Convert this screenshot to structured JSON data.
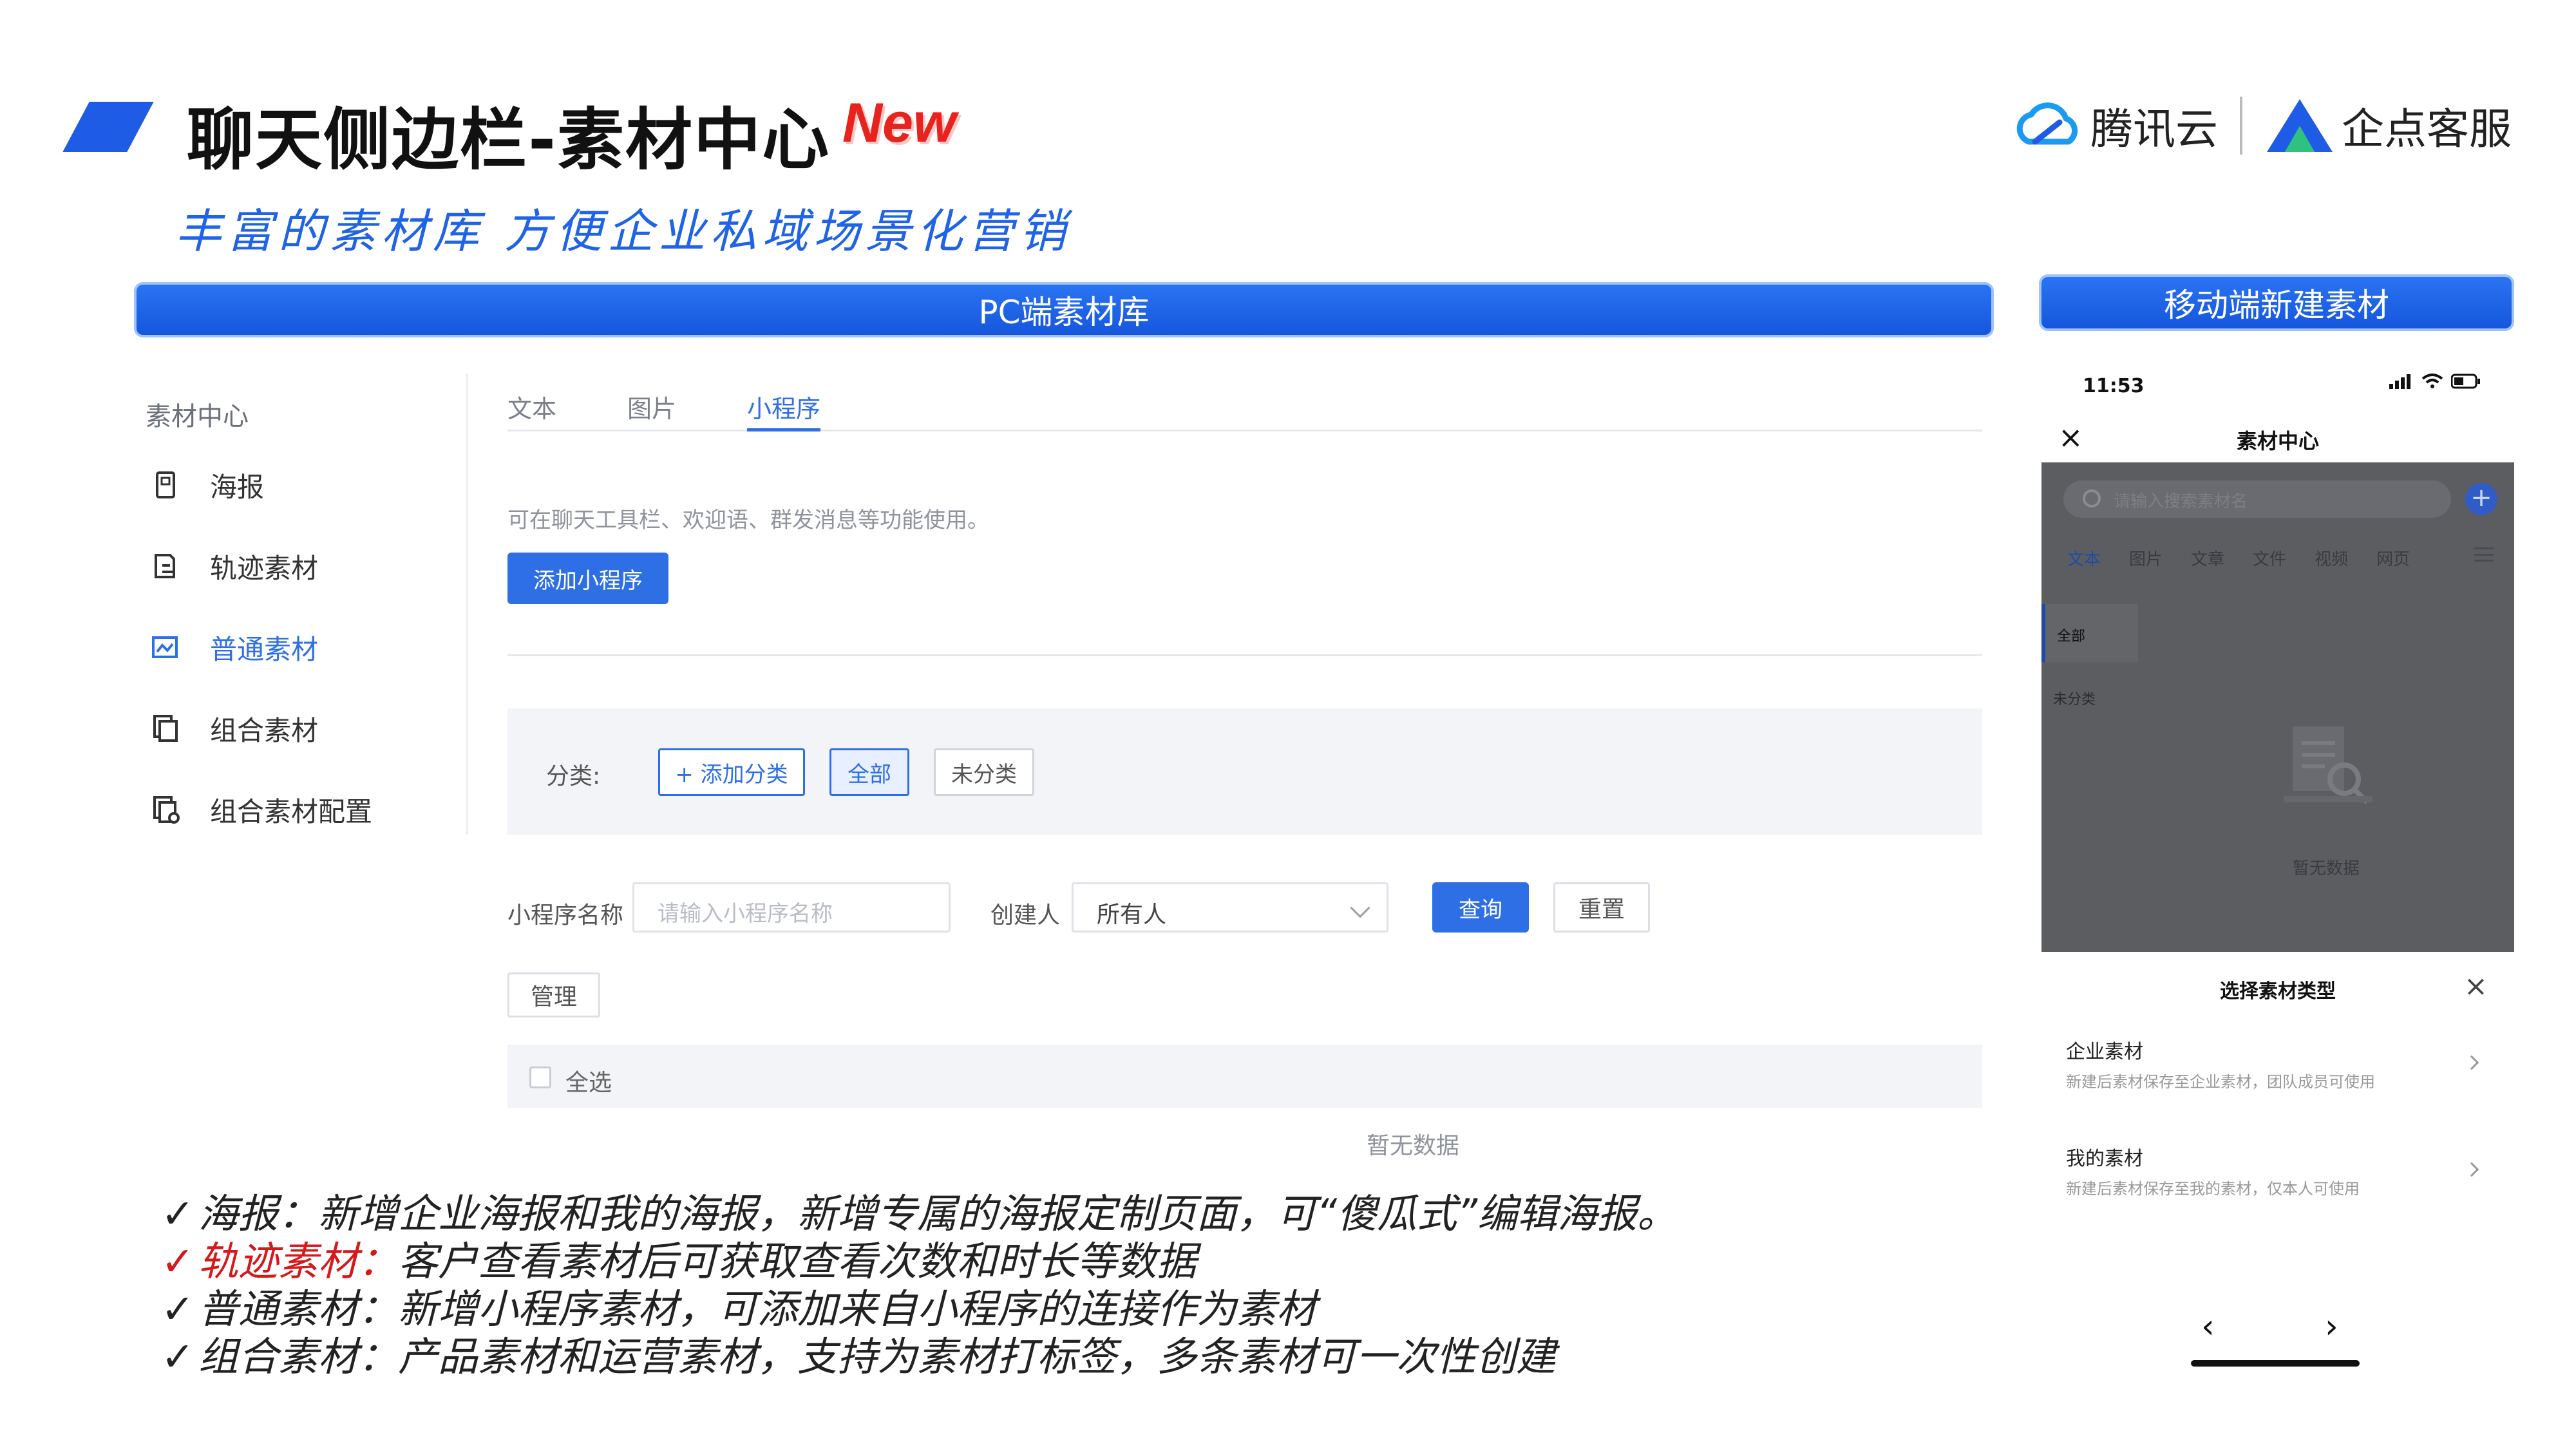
{
  "slide": {
    "title": "聊天侧边栏-素材中心",
    "badge": "New",
    "subtitle": "丰富的素材库 方便企业私域场景化营销",
    "logo_tencent": "腾讯云",
    "logo_qidian": "企点客服",
    "accent_color": "#1f5ce6"
  },
  "banners": {
    "pc": "PC端素材库",
    "mobile": "移动端新建素材"
  },
  "pc": {
    "sidebar_title": "素材中心",
    "nav": [
      {
        "label": "海报",
        "icon": "poster-icon"
      },
      {
        "label": "轨迹素材",
        "icon": "track-icon"
      },
      {
        "label": "普通素材",
        "icon": "normal-material-icon",
        "active": true
      },
      {
        "label": "组合素材",
        "icon": "combo-icon"
      },
      {
        "label": "组合素材配置",
        "icon": "combo-config-icon"
      }
    ],
    "tabs": [
      "文本",
      "图片",
      "小程序"
    ],
    "active_tab": "小程序",
    "hint": "可在聊天工具栏、欢迎语、群发消息等功能使用。",
    "add_button": "添加小程序",
    "filter": {
      "label": "分类:",
      "add_category": "+ 添加分类",
      "all": "全部",
      "uncategorized": "未分类"
    },
    "query": {
      "name_label": "小程序名称",
      "name_placeholder": "请输入小程序名称",
      "creator_label": "创建人",
      "creator_value": "所有人",
      "search_button": "查询",
      "reset_button": "重置"
    },
    "manage_button": "管理",
    "select_all": "全选",
    "empty": "暂无数据"
  },
  "mobile": {
    "time": "11:53",
    "page_title": "素材中心",
    "search_placeholder": "请输入搜索素材名",
    "tabs": [
      "文本",
      "图片",
      "文章",
      "文件",
      "视频",
      "网页"
    ],
    "active_tab": "文本",
    "cat_all": "全部",
    "cat_uncategorized": "未分类",
    "empty": "暂无数据",
    "sheet": {
      "title": "选择素材类型",
      "options": [
        {
          "title": "企业素材",
          "desc": "新建后素材保存至企业素材，团队成员可使用"
        },
        {
          "title": "我的素材",
          "desc": "新建后素材保存至我的素材，仅本人可使用"
        }
      ]
    },
    "nav_prev": "‹",
    "nav_next": "›"
  },
  "bullets": [
    {
      "check": "✓",
      "lead": "海报：",
      "text": "新增企业海报和我的海报，新增专属的海报定制页面，可“傻瓜式”编辑海报。",
      "highlight": false
    },
    {
      "check": "✓",
      "lead": "轨迹素材：",
      "text": "客户查看素材后可获取查看次数和时长等数据",
      "highlight": true,
      "highlight_color": "#d4191b"
    },
    {
      "check": "✓",
      "lead": "普通素材：",
      "text": "新增小程序素材，可添加来自小程序的连接作为素材",
      "highlight": false
    },
    {
      "check": "✓",
      "lead": "组合素材：",
      "text": "产品素材和运营素材，支持为素材打标签，多条素材可一次性创建",
      "highlight": false
    }
  ]
}
